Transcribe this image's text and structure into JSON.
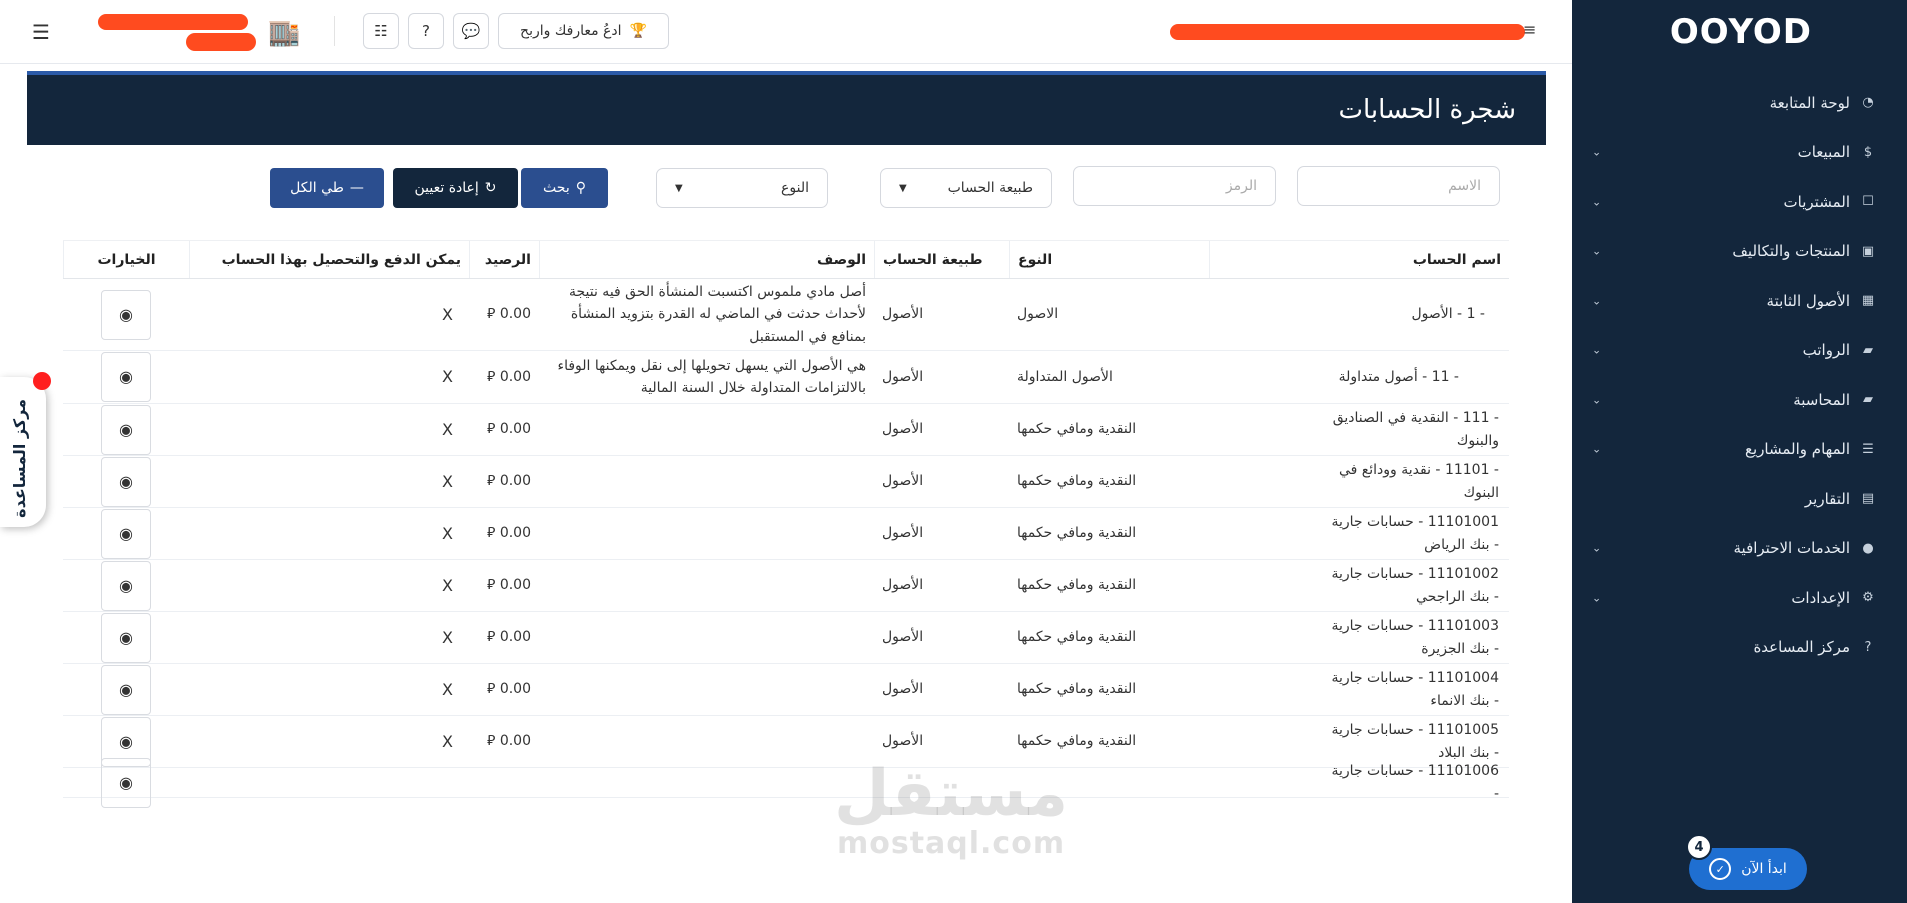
{
  "sidebar": {
    "logo": "OOYOD",
    "items": [
      {
        "label": "لوحة المتابعة",
        "icon": "gauge-icon",
        "glyph": "◔",
        "chevron": false
      },
      {
        "label": "المبيعات",
        "icon": "dollar-icon",
        "glyph": "$",
        "chevron": true
      },
      {
        "label": "المشتريات",
        "icon": "purchase-icon",
        "glyph": "☐",
        "chevron": true
      },
      {
        "label": "المنتجات والتكاليف",
        "icon": "box-icon",
        "glyph": "▣",
        "chevron": true
      },
      {
        "label": "الأصول الثابتة",
        "icon": "grid-icon",
        "glyph": "▦",
        "chevron": true
      },
      {
        "label": "الرواتب",
        "icon": "folder-icon",
        "glyph": "▰",
        "chevron": true
      },
      {
        "label": "المحاسبة",
        "icon": "folder-icon",
        "glyph": "▰",
        "chevron": true
      },
      {
        "label": "المهام والمشاريع",
        "icon": "tasks-icon",
        "glyph": "☰",
        "chevron": true
      },
      {
        "label": "التقارير",
        "icon": "report-icon",
        "glyph": "▤",
        "chevron": false
      },
      {
        "label": "الخدمات الاحترافية",
        "icon": "search-icon",
        "glyph": "●",
        "chevron": true
      },
      {
        "label": "الإعدادات",
        "icon": "gear-icon",
        "glyph": "⚙",
        "chevron": true
      },
      {
        "label": "مركز المساعدة",
        "icon": "help-icon",
        "glyph": "?",
        "chevron": false
      }
    ],
    "start_button": "ابدأ الآن",
    "start_badge": "4"
  },
  "topbar": {
    "invite_label": "ادعُ معارفك واربح"
  },
  "page": {
    "title": "شجرة الحسابات"
  },
  "filters": {
    "name_placeholder": "الاسم",
    "code_placeholder": "الرمز",
    "nature_select": "طبيعة الحساب",
    "type_select": "النوع",
    "search_label": "بحث",
    "reset_label": "إعادة تعيين",
    "collapse_label": "طي الكل"
  },
  "table": {
    "headers": {
      "name": "اسم الحساب",
      "type": "النوع",
      "nature": "طبيعة الحساب",
      "description": "الوصف",
      "balance": "الرصيد",
      "payable": "يمكن الدفع والتحصيل بهذا الحساب",
      "options": "الخيارات"
    },
    "rows": [
      {
        "name": "- 1 - الأصول",
        "type": "الاصول",
        "nature": "الأصول",
        "description": "أصل مادي ملموس اكتسبت المنشأة الحق فيه نتيجة لأحداث حدثت في الماضي له القدرة بتزويد المنشأة بمنافع في المستقبل",
        "balance": "0.00 ⃁",
        "payable": "X"
      },
      {
        "name": "- 11 - أصول متداولة",
        "type": "الأصول المتداولة",
        "nature": "الأصول",
        "description": "هي الأصول التي يسهل تحويلها إلى نقل ويمكنها الوفاء بالالتزامات المتداولة خلال السنة المالية",
        "balance": "0.00 ⃁",
        "payable": "X"
      },
      {
        "name": "- 111 - النقدية في الصناديق والبنوك",
        "type": "النقدية ومافي حكمها",
        "nature": "الأصول",
        "description": "",
        "balance": "0.00 ⃁",
        "payable": "X"
      },
      {
        "name": "- 11101 - نقدية وودائع في البنوك",
        "type": "النقدية ومافي حكمها",
        "nature": "الأصول",
        "description": "",
        "balance": "0.00 ⃁",
        "payable": "X"
      },
      {
        "name": "11101001 - حسابات جارية - بنك الرياض",
        "type": "النقدية ومافي حكمها",
        "nature": "الأصول",
        "description": "",
        "balance": "0.00 ⃁",
        "payable": "X"
      },
      {
        "name": "11101002 - حسابات جارية - بنك الراجحي",
        "type": "النقدية ومافي حكمها",
        "nature": "الأصول",
        "description": "",
        "balance": "0.00 ⃁",
        "payable": "X"
      },
      {
        "name": "11101003 - حسابات جارية - بنك الجزيرة",
        "type": "النقدية ومافي حكمها",
        "nature": "الأصول",
        "description": "",
        "balance": "0.00 ⃁",
        "payable": "X"
      },
      {
        "name": "11101004 - حسابات جارية - بنك الانماء",
        "type": "النقدية ومافي حكمها",
        "nature": "الأصول",
        "description": "",
        "balance": "0.00 ⃁",
        "payable": "X"
      },
      {
        "name": "11101005 - حسابات جارية - بنك البلاد",
        "type": "النقدية ومافي حكمها",
        "nature": "الأصول",
        "description": "",
        "balance": "0.00 ⃁",
        "payable": "X"
      },
      {
        "name": "11101006 - حسابات جارية -",
        "type": "",
        "nature": "",
        "description": "",
        "balance": "",
        "payable": ""
      }
    ]
  },
  "help_tab": "مركز المساعدة",
  "watermark": {
    "arabic": "مستقل",
    "latin": "mostaql.com"
  }
}
